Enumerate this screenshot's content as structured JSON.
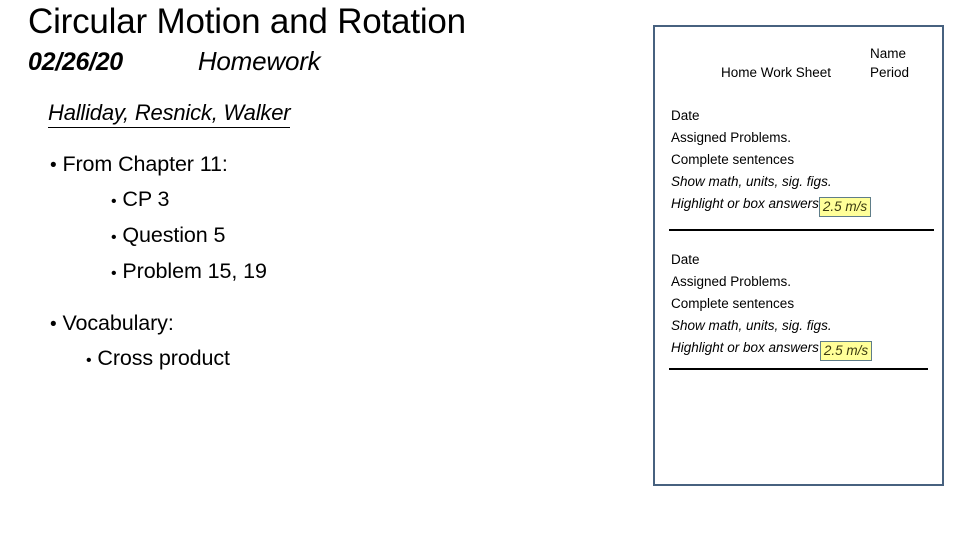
{
  "slide": {
    "title": "Circular Motion and Rotation",
    "date": "02/26/20",
    "kind": "Homework"
  },
  "body": {
    "source": "Halliday, Resnick, Walker",
    "bullets": [
      {
        "level": 1,
        "text": "From Chapter 11:"
      },
      {
        "level": 2,
        "text": "CP 3"
      },
      {
        "level": 2,
        "text": "Question 5"
      },
      {
        "level": 2,
        "text": "Problem 15, 19"
      },
      {
        "level": 1,
        "text": "Vocabulary:"
      },
      {
        "level": 2,
        "text": "Cross product"
      }
    ],
    "bullet_glyph": "•"
  },
  "sheet": {
    "title": "Home Work Sheet",
    "name_label": "Name",
    "period_label": "Period",
    "border_color": "#47617f",
    "entries": [
      {
        "date_label": "Date",
        "assigned_label": "Assigned Problems.",
        "sentences_label": "Complete sentences",
        "show_math_label": "Show math, units, sig. figs.",
        "highlight_label": "Highlight or box answers",
        "answer_value": "2.5 m/s",
        "highlight_color": "#ffff99"
      },
      {
        "date_label": "Date",
        "assigned_label": "Assigned Problems.",
        "sentences_label": "Complete sentences",
        "show_math_label": "Show math, units, sig. figs.",
        "highlight_label": "Highlight or box answers",
        "answer_value": "2.5 m/s",
        "highlight_color": "#ffff99"
      }
    ]
  }
}
